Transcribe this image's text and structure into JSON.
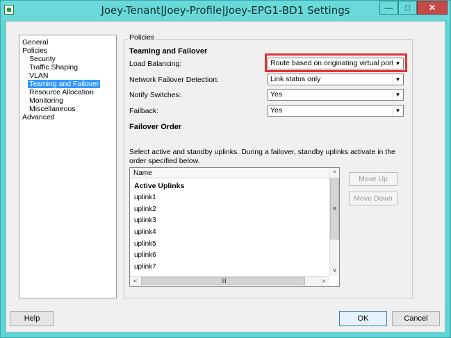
{
  "window": {
    "title": "Joey-Tenant|Joey-Profile|Joey-EPG1-BD1 Settings",
    "controls": {
      "minimize": "—",
      "maximize": "□",
      "close": "✕"
    }
  },
  "tree": {
    "items": [
      {
        "label": "General"
      },
      {
        "label": "Policies"
      },
      {
        "label": "Security"
      },
      {
        "label": "Traffic Shaping"
      },
      {
        "label": "VLAN"
      },
      {
        "label": "Teaming and Failover"
      },
      {
        "label": "Resource Allocation"
      },
      {
        "label": "Monitoring"
      },
      {
        "label": "Miscellaneous"
      },
      {
        "label": "Advanced"
      }
    ],
    "selected": "Teaming and Failover"
  },
  "policies": {
    "group_label": "Policies",
    "section_title": "Teaming and Failover",
    "rows": [
      {
        "label": "Load Balancing:",
        "value": "Route based on originating virtual port"
      },
      {
        "label": "Network Failover Detection:",
        "value": "Link status only"
      },
      {
        "label": "Notify Switches:",
        "value": "Yes"
      },
      {
        "label": "Failback:",
        "value": "Yes"
      }
    ],
    "failover_order_title": "Failover Order",
    "instructions_line1": "Select active and standby uplinks. During a failover, standby uplinks activate in the",
    "instructions_line2": "order specified below.",
    "list": {
      "header": "Name",
      "group_heading": "Active Uplinks",
      "items": [
        "uplink1",
        "uplink2",
        "uplink3",
        "uplink4",
        "uplink5",
        "uplink6",
        "uplink7"
      ],
      "scroll_glyphs": {
        "up": "^",
        "down": "v",
        "left": "<",
        "right": ">",
        "vgrip": "≡",
        "hgrip": "III"
      }
    },
    "move_up_label": "Move Up",
    "move_down_label": "Move Down"
  },
  "footer": {
    "help_label": "Help",
    "ok_label": "OK",
    "cancel_label": "Cancel"
  },
  "icons": {
    "app": "app-icon",
    "dropdown": "chevron-down-icon"
  },
  "colors": {
    "title_bar": "#6ad9d9",
    "selection": "#3399ff",
    "highlight_box": "#e03434",
    "close_button": "#c74a4a"
  }
}
